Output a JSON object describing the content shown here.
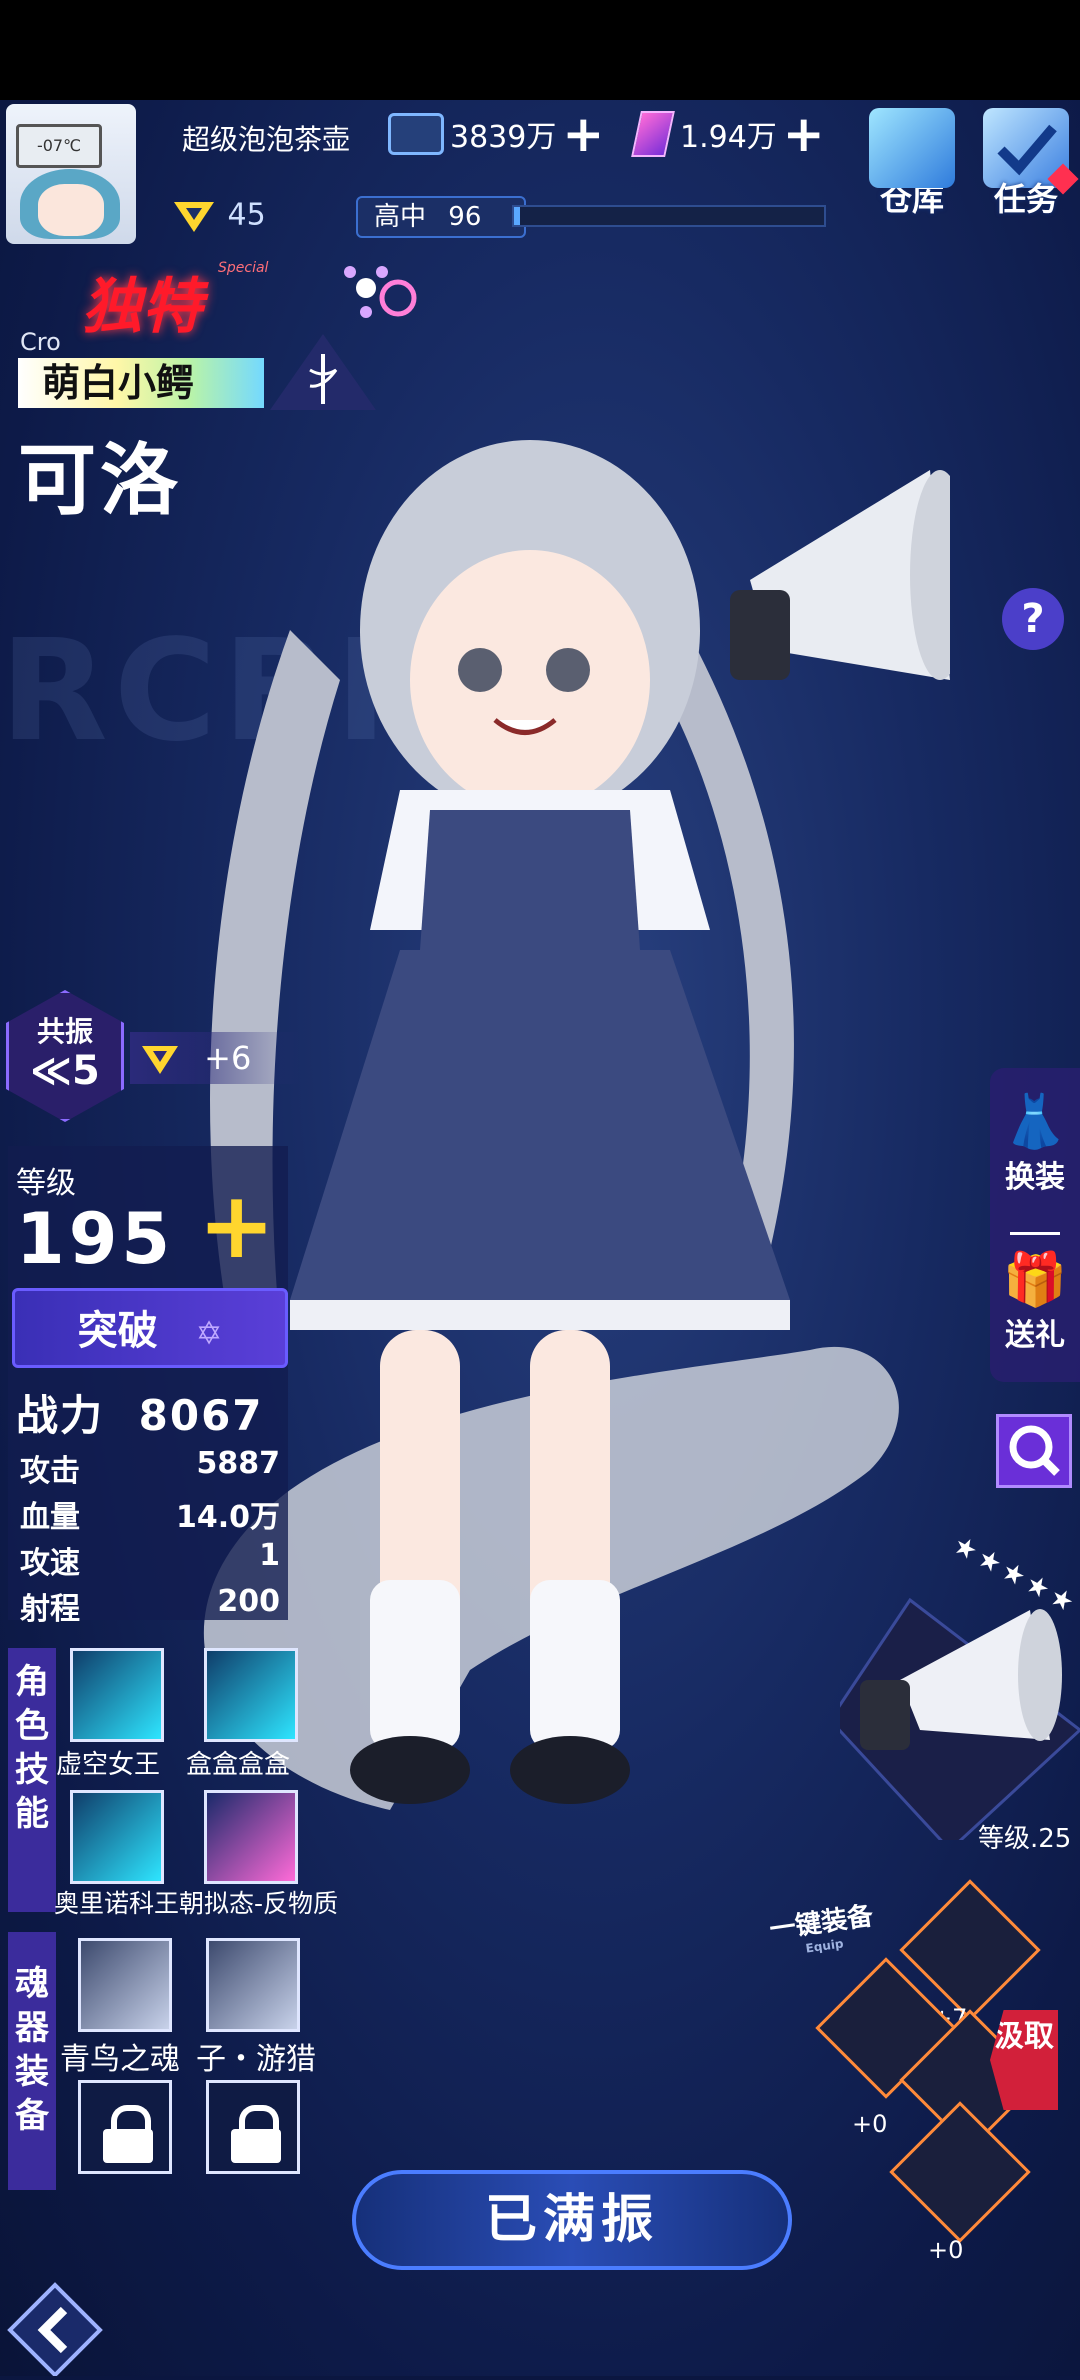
{
  "header": {
    "avatar_screen_text": "-07℃",
    "player_name": "超级泡泡茶壶",
    "currency_1": "3839万",
    "currency_2": "1.94万",
    "warehouse_label": "仓库",
    "tasks_label": "任务",
    "player_level": "45",
    "rank_label": "高中",
    "rank_value": "96"
  },
  "character": {
    "rarity_label": "独特",
    "rarity_sub": "Special",
    "english_name": "Cro",
    "title_tag": "萌白小鳄",
    "name": "可洛",
    "help_icon": "?"
  },
  "resonance": {
    "label": "共振",
    "value": "≪5",
    "bonus": "+6"
  },
  "stats": {
    "level_label": "等级",
    "level_value": "195",
    "breakthrough_label": "突破",
    "power_label": "战力",
    "power_value": "8067",
    "rows": [
      {
        "label": "攻击",
        "value": "5887"
      },
      {
        "label": "血量",
        "value": "14.0万"
      },
      {
        "label": "攻速",
        "value": "1"
      },
      {
        "label": "射程",
        "value": "200"
      }
    ]
  },
  "skills": {
    "section_label": "角色技能",
    "items": [
      {
        "name": "虚空女王"
      },
      {
        "name": "盒盒盒盒"
      },
      {
        "name": "奥里诺科王朝拟态-反物质"
      }
    ]
  },
  "soul": {
    "section_label": "魂器装备",
    "items": [
      {
        "name": "青鸟之魂"
      },
      {
        "name": "子・游猎"
      }
    ]
  },
  "right_menu": {
    "outfit_label": "换装",
    "gift_label": "送礼"
  },
  "weapon": {
    "stars": "★★★★★",
    "level_text": "等级.25"
  },
  "equipment": {
    "equip_all_label": "一键装备",
    "equip_all_sub": "Equip",
    "slots": [
      {
        "label": "+7"
      },
      {
        "label": "+0"
      },
      {
        "label": "+0"
      },
      {
        "label": "+0"
      }
    ],
    "claim_label": "汲取"
  },
  "main_button": "已满振",
  "colors": {
    "accent_purple": "#6a2fd8",
    "special_red": "#ff1a2a",
    "level_plus_yellow": "#ffd62e",
    "equip_orange": "#ff8a3a"
  }
}
